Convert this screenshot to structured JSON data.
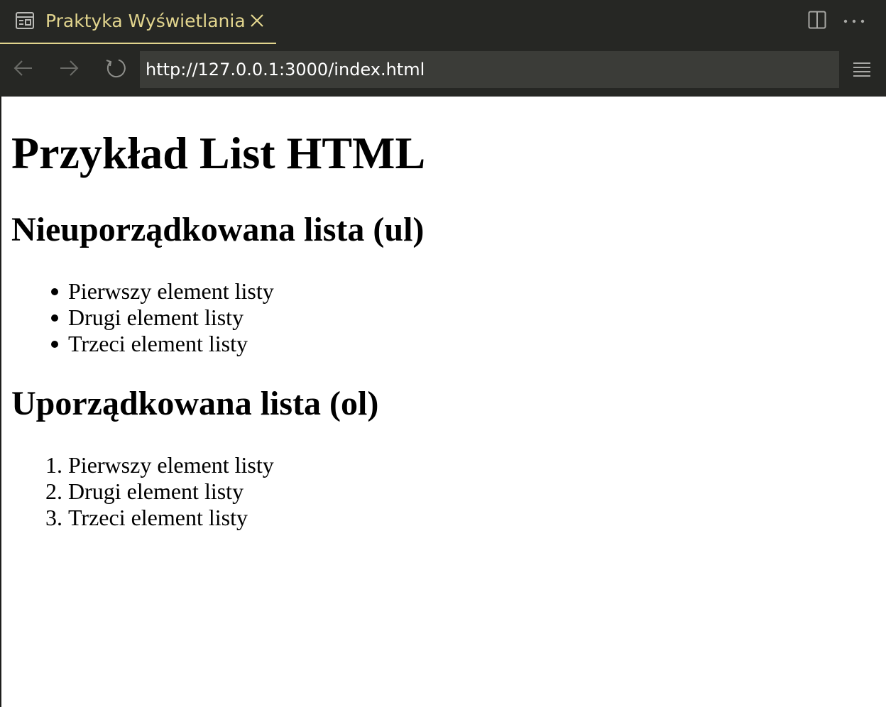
{
  "tab": {
    "title": "Praktyka Wyświetlania",
    "icon": "preview-icon",
    "accent": "#e2d58e"
  },
  "toolbar": {
    "split_icon": "split-editor-icon",
    "more_icon": "more-actions-icon"
  },
  "nav": {
    "back_icon": "back-arrow-icon",
    "forward_icon": "forward-arrow-icon",
    "reload_icon": "reload-icon",
    "url": "http://127.0.0.1:3000/index.html",
    "menu_icon": "menu-icon"
  },
  "page": {
    "title": "Przykład List HTML",
    "ul_heading": "Nieuporządkowana lista (ul)",
    "ul_items": [
      "Pierwszy element listy",
      "Drugi element listy",
      "Trzeci element listy"
    ],
    "ol_heading": "Uporządkowana lista (ol)",
    "ol_items": [
      "Pierwszy element listy",
      "Drugi element listy",
      "Trzeci element listy"
    ],
    "ol_numbers": [
      "1.",
      "2.",
      "3."
    ]
  }
}
